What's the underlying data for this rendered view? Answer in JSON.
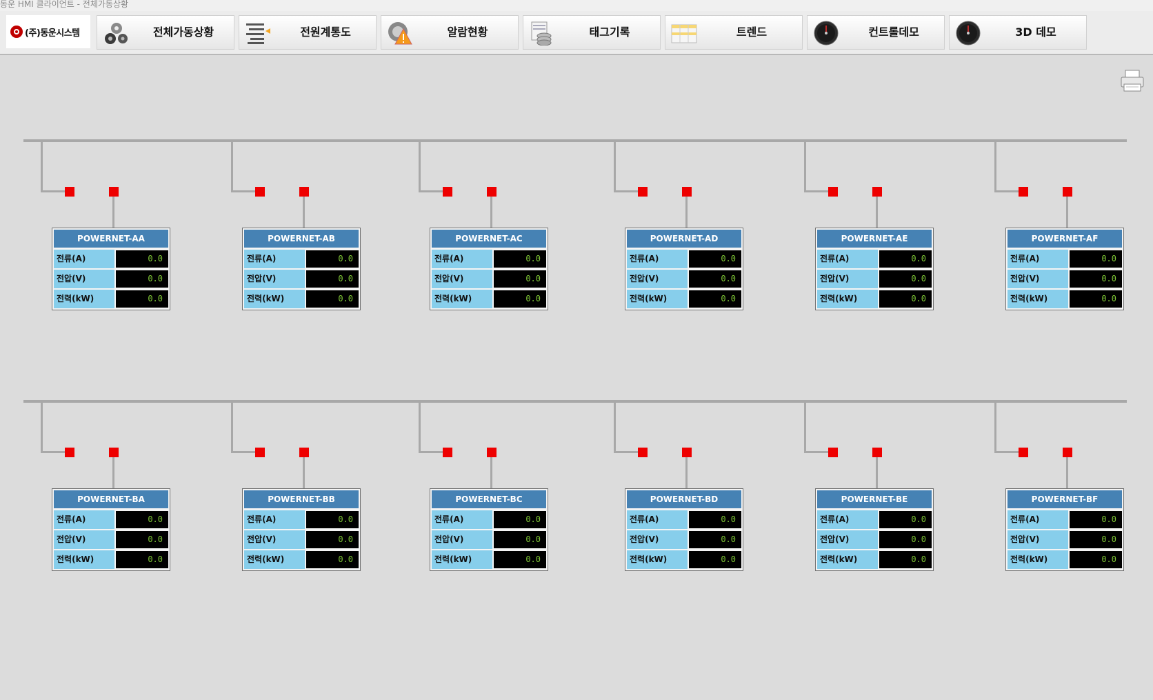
{
  "window": {
    "title": "동운 HMI 클라이언트 - 전체가동상황"
  },
  "logo": {
    "text": "(주)동운시스템"
  },
  "tabs": [
    {
      "label": "전체가동상황",
      "icon": "gears-icon"
    },
    {
      "label": "전원계통도",
      "icon": "power-lines-icon"
    },
    {
      "label": "알람현황",
      "icon": "alarm-warning-icon"
    },
    {
      "label": "태그기록",
      "icon": "database-log-icon"
    },
    {
      "label": "트렌드",
      "icon": "trend-table-icon"
    },
    {
      "label": "컨트롤데모",
      "icon": "gauge-icon"
    },
    {
      "label": "3D 데모",
      "icon": "gauge-icon"
    }
  ],
  "colors": {
    "panel_header": "#4682b4",
    "label_bg": "#87ceeb",
    "value_text": "#7fc636",
    "indicator": "#ee0000",
    "bus_line": "#a8a8a8"
  },
  "row_labels": [
    "전류(A)",
    "전압(V)",
    "전력(kW)"
  ],
  "panels": [
    {
      "name": "POWERNET-AA",
      "values": [
        "0.0",
        "0.0",
        "0.0"
      ]
    },
    {
      "name": "POWERNET-AB",
      "values": [
        "0.0",
        "0.0",
        "0.0"
      ]
    },
    {
      "name": "POWERNET-AC",
      "values": [
        "0.0",
        "0.0",
        "0.0"
      ]
    },
    {
      "name": "POWERNET-AD",
      "values": [
        "0.0",
        "0.0",
        "0.0"
      ]
    },
    {
      "name": "POWERNET-AE",
      "values": [
        "0.0",
        "0.0",
        "0.0"
      ]
    },
    {
      "name": "POWERNET-AF",
      "values": [
        "0.0",
        "0.0",
        "0.0"
      ]
    },
    {
      "name": "POWERNET-BA",
      "values": [
        "0.0",
        "0.0",
        "0.0"
      ]
    },
    {
      "name": "POWERNET-BB",
      "values": [
        "0.0",
        "0.0",
        "0.0"
      ]
    },
    {
      "name": "POWERNET-BC",
      "values": [
        "0.0",
        "0.0",
        "0.0"
      ]
    },
    {
      "name": "POWERNET-BD",
      "values": [
        "0.0",
        "0.0",
        "0.0"
      ]
    },
    {
      "name": "POWERNET-BE",
      "values": [
        "0.0",
        "0.0",
        "0.0"
      ]
    },
    {
      "name": "POWERNET-BF",
      "values": [
        "0.0",
        "0.0",
        "0.0"
      ]
    }
  ]
}
